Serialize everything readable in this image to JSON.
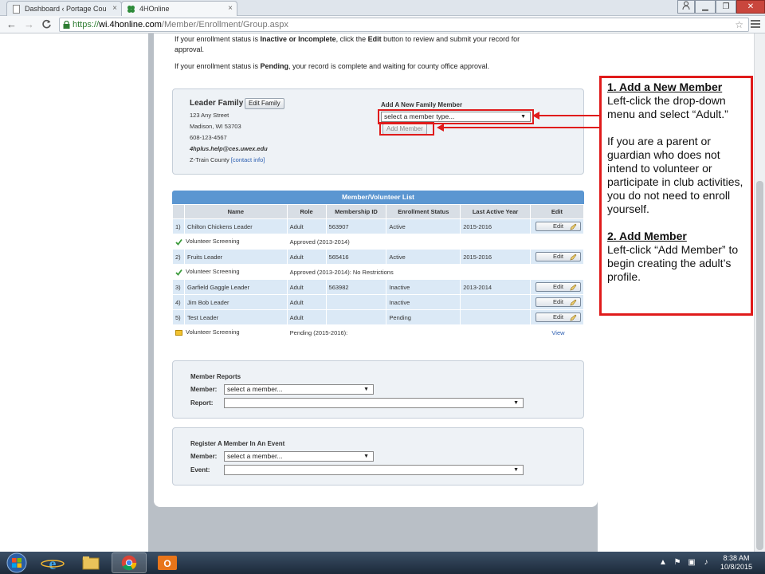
{
  "browser": {
    "tabs": [
      {
        "title": "Dashboard ‹ Portage Cou",
        "close": "×"
      },
      {
        "title": "4HOnline",
        "close": "×"
      }
    ],
    "url": {
      "scheme": "https://",
      "host": "wi.4honline.com",
      "path": "/Member/Enrollment/Group.aspx"
    },
    "nav": {
      "back": "←",
      "forward": "→",
      "reload": "C"
    },
    "star": "☆"
  },
  "intro": {
    "line1_pre": "If your enrollment status is ",
    "line1_b1": "Inactive or Incomplete",
    "line1_mid": ", click the ",
    "line1_b2": "Edit",
    "line1_post": " button to review and submit your record for",
    "line1b": "approval.",
    "line2_pre": "If your enrollment status is ",
    "line2_b": "Pending",
    "line2_post": ", your record is complete and waiting for county office approval."
  },
  "family": {
    "name": "Leader Family",
    "edit_label": "Edit Family",
    "street": "123 Any Street",
    "city": "Madison, WI 53703",
    "phone": "608-123-4567",
    "email": "4hplus.help@ces.uwex.edu",
    "county": "Z-Train County",
    "contact_link": "[contact info]",
    "add_label": "Add A New Family Member",
    "member_type_placeholder": "select a member type...",
    "add_button": "Add Member"
  },
  "member_list": {
    "title": "Member/Volunteer List",
    "columns": [
      "Name",
      "Role",
      "Membership ID",
      "Enrollment Status",
      "Last Active Year",
      "Edit"
    ],
    "rows": [
      {
        "num": "1)",
        "name": "Chilton Chickens Leader",
        "role": "Adult",
        "id": "563907",
        "status": "Active",
        "year": "2015-2016",
        "edit": "Edit"
      },
      {
        "screening": "Volunteer Screening",
        "screening_status": "Approved (2013-2014)",
        "view": ""
      },
      {
        "num": "2)",
        "name": "Fruits Leader",
        "role": "Adult",
        "id": "565416",
        "status": "Active",
        "year": "2015-2016",
        "edit": "Edit"
      },
      {
        "screening": "Volunteer Screening",
        "screening_status": "Approved (2013-2014): No Restrictions",
        "view": ""
      },
      {
        "num": "3)",
        "name": "Garfield Gaggle Leader",
        "role": "Adult",
        "id": "563982",
        "status": "Inactive",
        "year": "2013-2014",
        "edit": "Edit"
      },
      {
        "num": "4)",
        "name": "Jim Bob Leader",
        "role": "Adult",
        "id": "",
        "status": "Inactive",
        "year": "",
        "edit": "Edit"
      },
      {
        "num": "5)",
        "name": "Test Leader",
        "role": "Adult",
        "id": "",
        "status": "Pending",
        "year": "",
        "edit": "Edit"
      },
      {
        "screening": "Volunteer Screening",
        "screening_status": "Pending (2015-2016):",
        "view": "View"
      }
    ]
  },
  "reports": {
    "title": "Member Reports",
    "member_label": "Member:",
    "member_value": "select a member...",
    "report_label": "Report:",
    "report_value": ""
  },
  "event": {
    "title": "Register A Member In An Event",
    "member_label": "Member:",
    "member_value": "select a member...",
    "event_label": "Event:",
    "event_value": ""
  },
  "callout": {
    "step1_title": "1. Add a New Member",
    "step1_text": "Left-click the drop-down menu and select “Adult.”",
    "step1_note": "If you are a parent or guardian who does not intend to volunteer or participate in club activities, you do not need to enroll yourself.",
    "step2_title": "2. Add Member",
    "step2_text": "Left-click “Add Member” to begin creating the adult’s profile."
  },
  "taskbar": {
    "time": "8:38 AM",
    "date": "10/8/2015"
  },
  "colors": {
    "highlight": "#e01b1b",
    "list_header": "#5b96d1",
    "row_bg": "#dbe9f6",
    "link": "#2a5db0"
  }
}
